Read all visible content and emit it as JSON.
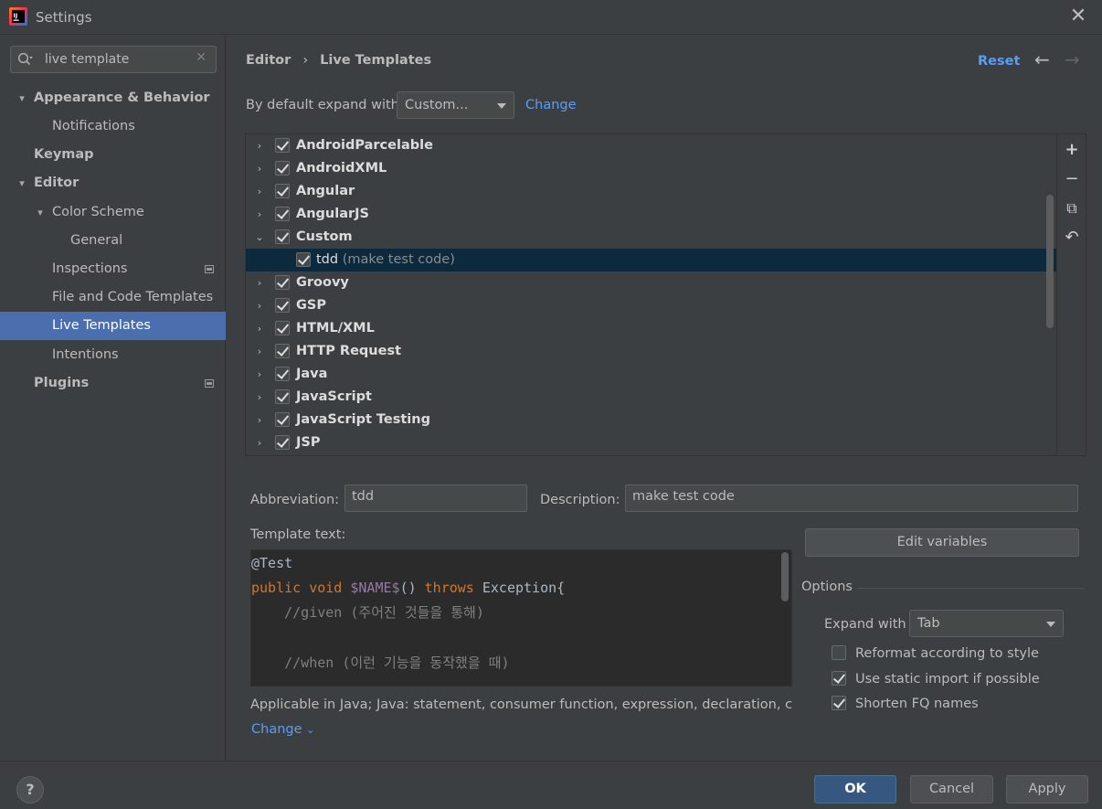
{
  "window": {
    "title": "Settings",
    "close_symbol": "✕"
  },
  "sidebar": {
    "search": {
      "value": "live template",
      "placeholder": ""
    },
    "items": [
      {
        "label": "Appearance & Behavior",
        "expanded": true
      },
      {
        "label": "Notifications"
      },
      {
        "label": "Keymap"
      },
      {
        "label": "Editor",
        "expanded": true
      },
      {
        "label": "Color Scheme",
        "expanded": true
      },
      {
        "label": "General"
      },
      {
        "label": "Inspections"
      },
      {
        "label": "File and Code Templates"
      },
      {
        "label": "Live Templates",
        "selected": true
      },
      {
        "label": "Intentions"
      },
      {
        "label": "Plugins"
      }
    ]
  },
  "header": {
    "breadcrumb": [
      "Editor",
      "Live Templates"
    ],
    "breadcrumb_sep": "›",
    "reset_label": "Reset",
    "back_symbol": "←",
    "forward_symbol": "→"
  },
  "expand_default": {
    "label": "By default expand with",
    "value": "Custom...",
    "change_label": "Change"
  },
  "template_groups": [
    {
      "name": "AndroidParcelable",
      "checked": true
    },
    {
      "name": "AndroidXML",
      "checked": true
    },
    {
      "name": "Angular",
      "checked": true
    },
    {
      "name": "AngularJS",
      "checked": true
    },
    {
      "name": "Custom",
      "checked": true,
      "expanded": true
    },
    {
      "name": "tdd",
      "desc": "(make test code)",
      "checked": true,
      "child": true,
      "selected": true
    },
    {
      "name": "Groovy",
      "checked": true
    },
    {
      "name": "GSP",
      "checked": true
    },
    {
      "name": "HTML/XML",
      "checked": true
    },
    {
      "name": "HTTP Request",
      "checked": true
    },
    {
      "name": "Java",
      "checked": true
    },
    {
      "name": "JavaScript",
      "checked": true
    },
    {
      "name": "JavaScript Testing",
      "checked": true
    },
    {
      "name": "JSP",
      "checked": true
    }
  ],
  "toolbar_symbols": {
    "add": "+",
    "remove": "−",
    "copy": "⧉",
    "restore": "↶"
  },
  "detail": {
    "abbreviation_label": "Abbreviation:",
    "abbreviation_value": "tdd",
    "description_label": "Description:",
    "description_value": "make test code",
    "template_text_label": "Template text:",
    "code": {
      "line1": "@Test",
      "line2_kw1": "public",
      "line2_kw2": "void",
      "line2_var": "$NAME$",
      "line2_paren": "()",
      "line2_kw3": "throws",
      "line2_rest": "Exception{",
      "line3": "    //given (주어진 것들을 통해)",
      "line4": "",
      "line5": "    //when (이런 기능을 동작했을 때)"
    },
    "applicable_text": "Applicable in Java; Java: statement, consumer function, expression, declaration, comment",
    "change_label": "Change",
    "edit_variables_label": "Edit variables"
  },
  "options": {
    "title": "Options",
    "expand_with_label": "Expand with",
    "expand_with_value": "Tab",
    "reformat_label": "Reformat according to style",
    "reformat_checked": false,
    "static_import_label": "Use static import if possible",
    "static_import_checked": true,
    "shorten_fq_label": "Shorten FQ names",
    "shorten_fq_checked": true
  },
  "footer": {
    "help_label": "?",
    "ok_label": "OK",
    "cancel_label": "Cancel",
    "apply_label": "Apply"
  },
  "colors": {
    "accent": "#4b6eaf",
    "link": "#589df6",
    "selection": "#0d293e",
    "primary_button": "#365880"
  }
}
